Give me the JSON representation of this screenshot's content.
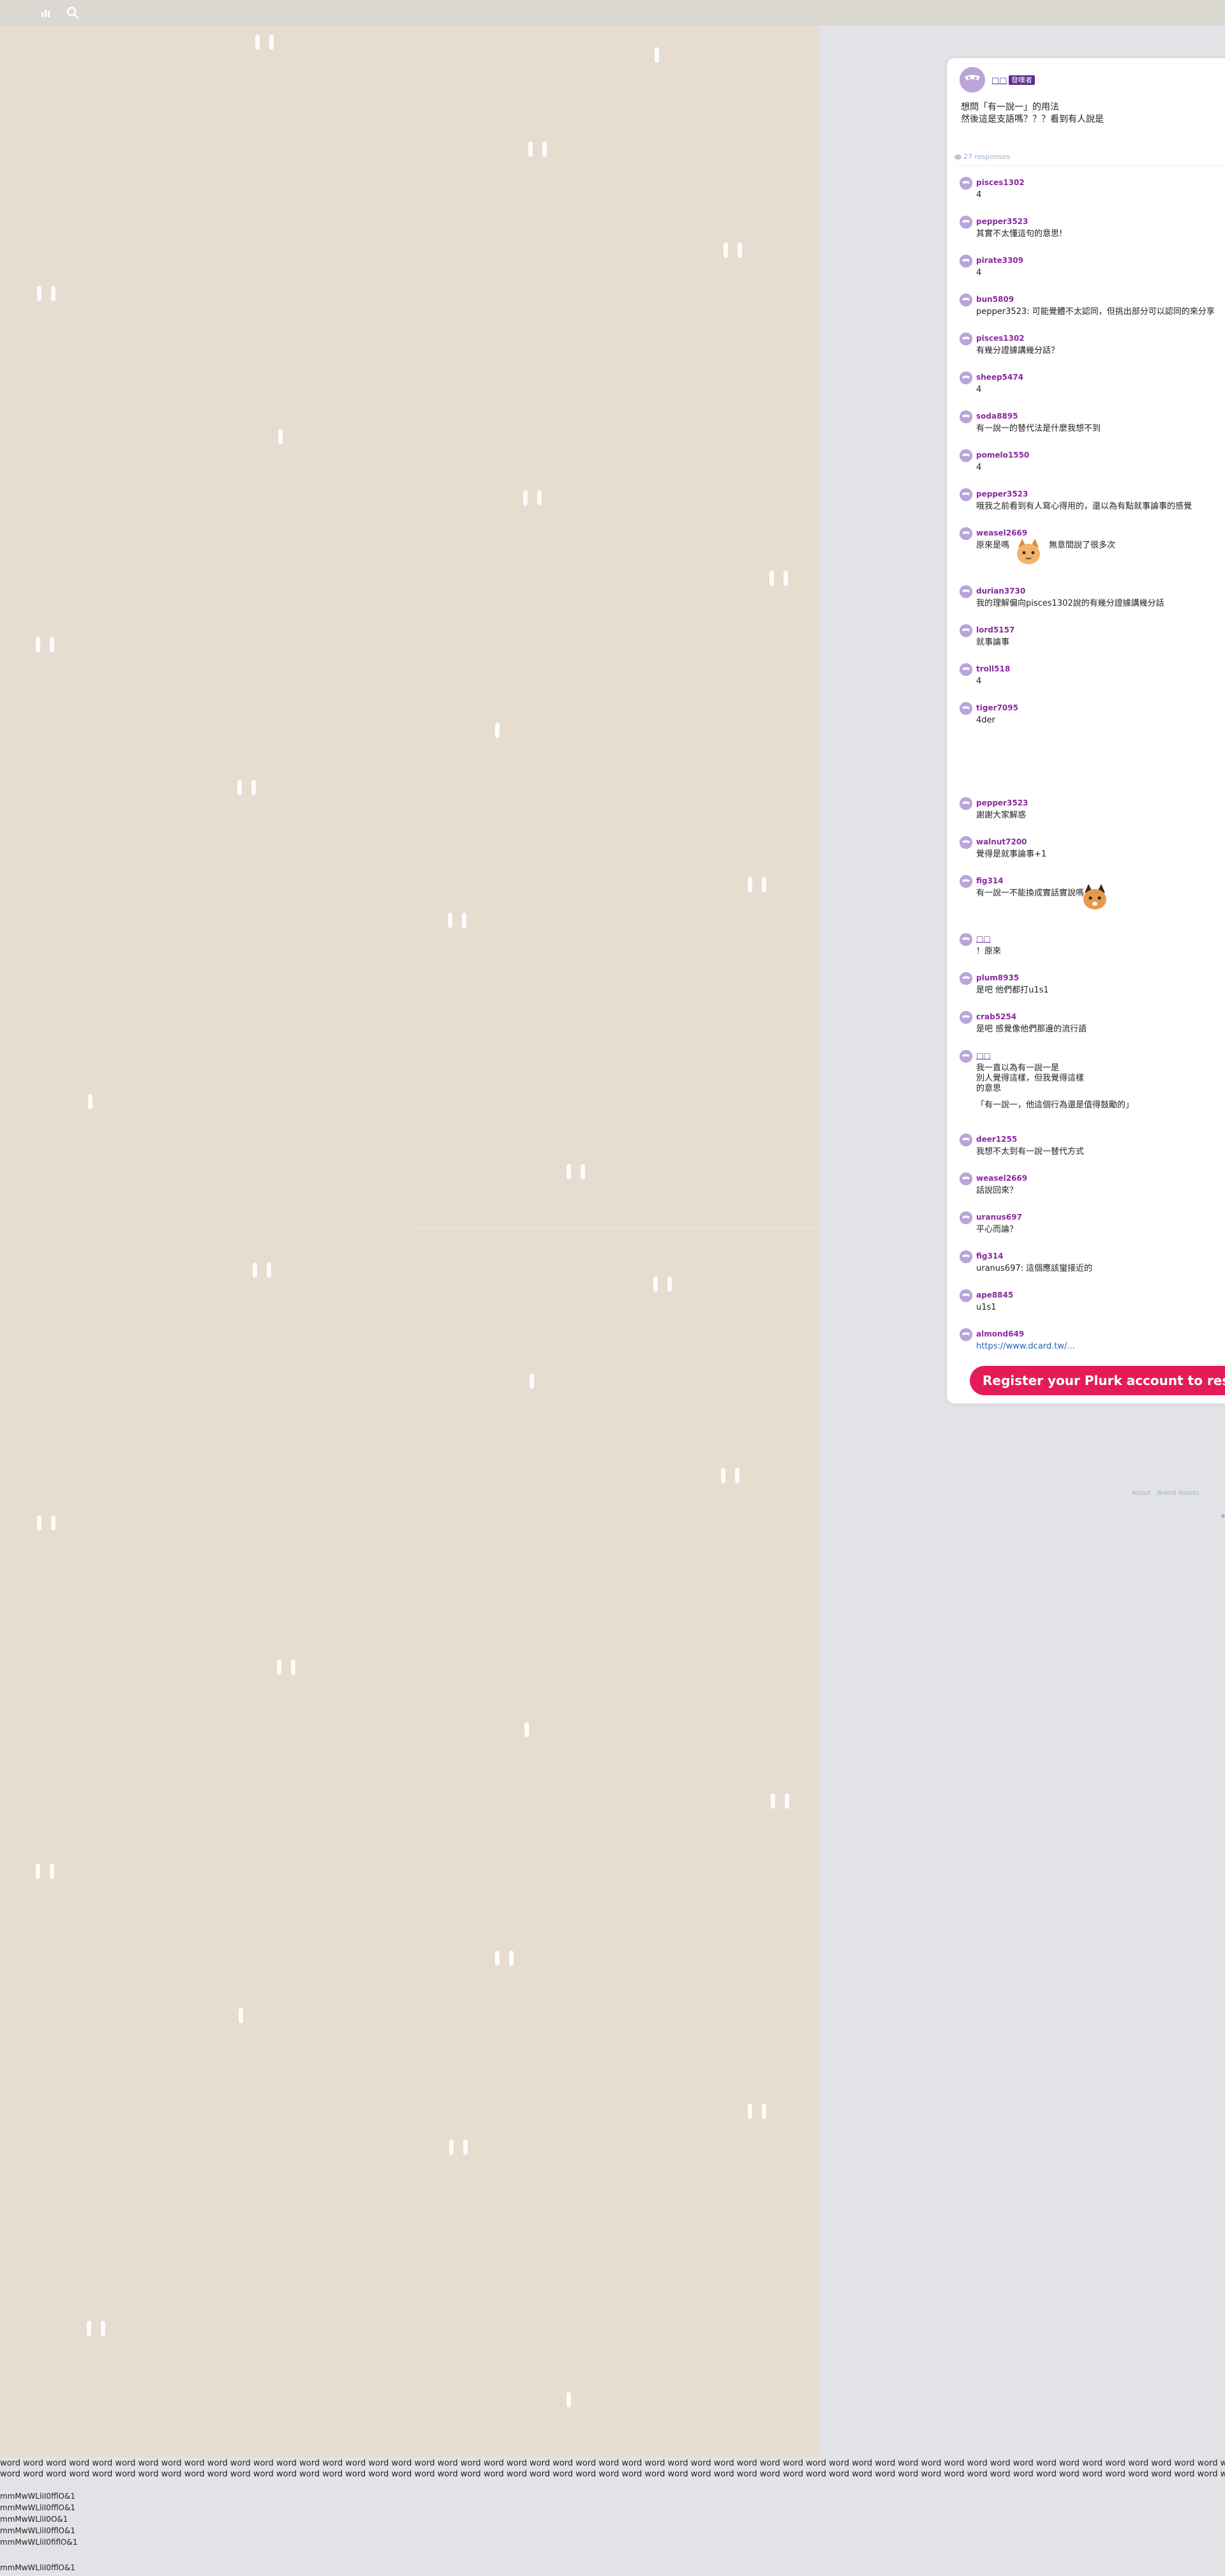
{
  "topbar": {
    "icons": [
      "chart-icon",
      "search-icon"
    ]
  },
  "plurk": {
    "owner": {
      "name": "□□",
      "badge": "發噗者"
    },
    "content_lines": [
      "想問「有一說一」的用法",
      "然後這是支語嗎？？？看到有人說是"
    ],
    "response_count": "27 responses"
  },
  "responses": [
    {
      "user": "pisces1302",
      "text": "4"
    },
    {
      "user": "pepper3523",
      "text": "其實不太懂這句的意思!"
    },
    {
      "user": "pirate3309",
      "text": "4"
    },
    {
      "user": "bun5809",
      "text": "pepper3523: 可能覺體不太認同，但挑出部分可以認同的來分享"
    },
    {
      "user": "pisces1302",
      "text": "有幾分證據講幾分話？"
    },
    {
      "user": "sheep5474",
      "text": "4"
    },
    {
      "user": "soda8895",
      "text": "有一說一的替代法是什麼我想不到"
    },
    {
      "user": "pomelo1550",
      "text": "4"
    },
    {
      "user": "pepper3523",
      "text": "哦我之前看到有人寫心得用的，還以為有點就事論事的感覺"
    },
    {
      "user": "weasel2669",
      "text": "原來是嗎",
      "text_after": "無意間說了很多次"
    },
    {
      "user": "durian3730",
      "text": "我的理解偏向pisces1302說的有幾分證據講幾分話"
    },
    {
      "user": "lord5157",
      "text": "就事論事"
    },
    {
      "user": "troll518",
      "text": "4"
    },
    {
      "user": "tiger7095",
      "text": "4der"
    },
    {
      "user": "pepper3523",
      "text": "謝謝大家解惑"
    },
    {
      "user": "walnut7200",
      "text": "覺得是就事論事+1"
    },
    {
      "user": "fig314",
      "text": "有一說一不能換成實話實說嗎"
    },
    {
      "user": "□□",
      "text": "！原來"
    },
    {
      "user": "plum8935",
      "text": "是吧 他們都打u1s1"
    },
    {
      "user": "crab5254",
      "text": "是吧 感覺像他們那邊的流行語"
    },
    {
      "user": "□□",
      "lines": [
        "我一直以為有一說一是",
        "別人覺得這樣，但我覺得這樣",
        "的意思",
        "「有一說一，他這個行為還是值得鼓勵的」"
      ]
    },
    {
      "user": "deer1255",
      "text": "我想不太到有一說一替代方式"
    },
    {
      "user": "weasel2669",
      "text": "話說回來？"
    },
    {
      "user": "uranus697",
      "text": "平心而論？"
    },
    {
      "user": "fig314",
      "text": "uranus697: 這個應該蠻接近的"
    },
    {
      "user": "ape8845",
      "text": "u1s1"
    },
    {
      "user": "almond649",
      "text": "https://www.dcard.tw/..."
    }
  ],
  "register_label": "Register your Plurk account to respond",
  "footer": {
    "links": [
      "About",
      "Brand Assets"
    ]
  },
  "text_rows": {
    "word_line": "word word word word word word word word word word word word word word word word word word word word word word word word word word word word word word word word word word word word word word word word word word word word word word word word word word word word word word word word word word word word word word word word word word word word word word word word word word word word word word word word word word word word word word word word word word word word word word word word word word word word word word word word word word word word word word word word word word word word word word word word",
    "font_lines": [
      "mmMwWLliI0fflO&1",
      "mmMwWLliI0fflO&1",
      "mmMwWLliI0O&1",
      "mmMwWLliI0fflO&1",
      "mmMwWLliI0fiflO&1",
      "mmMwWLliI0fflO&1"
    ]
  },
  "colors": {
    "background_panel": "#e6dcd0",
    "register_button": "#e31c57",
    "username": "#8a2aa0",
    "badge": "#5a2b8c"
  }
}
